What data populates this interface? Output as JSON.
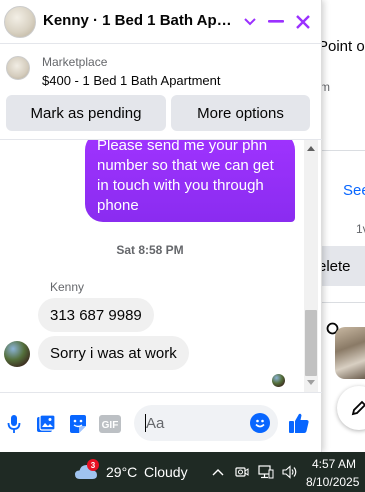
{
  "background_page": {
    "title_fragment": "Point o",
    "subtitle_fragment": "m",
    "see_link": "See",
    "small_fragment": "1v",
    "delete_fragment": "elete"
  },
  "chat": {
    "title": "Kenny · 1 Bed 1 Bath Apart...",
    "listing": {
      "source": "Marketplace",
      "title": "$400 - 1 Bed 1 Bath Apartment"
    },
    "actions": {
      "mark_pending": "Mark as pending",
      "more_options": "More options"
    },
    "messages": {
      "outgoing_text": "Please send me your phn number so that we can get in touch with you through phone",
      "timestamp": "Sat 8:58 PM",
      "sender_name": "Kenny",
      "incoming": [
        "313 687 9989",
        "Sorry i was at work"
      ]
    },
    "composer": {
      "placeholder": "Aa",
      "gif_label": "GIF"
    },
    "accent_color": "#0866ff",
    "bubble_color": "#9b30ff"
  },
  "taskbar": {
    "weather_badge": "3",
    "temperature": "29°C",
    "condition": "Cloudy",
    "time": "4:57 AM",
    "date": "8/10/2025"
  }
}
